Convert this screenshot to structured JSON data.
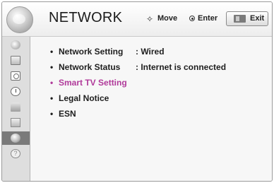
{
  "header": {
    "title": "NETWORK",
    "hints": {
      "move_label": "Move",
      "move_icon": "four-way-arrow-icon",
      "enter_label": "Enter",
      "enter_icon": "enter-dot-icon"
    },
    "exit_button": {
      "label": "Exit",
      "icon": "exit-key-icon"
    }
  },
  "sidebar": {
    "items": [
      {
        "icon": "picture-icon",
        "selected": false
      },
      {
        "icon": "screen-icon",
        "selected": false
      },
      {
        "icon": "audio-icon",
        "selected": false
      },
      {
        "icon": "time-icon",
        "selected": false
      },
      {
        "icon": "lock-icon",
        "selected": false
      },
      {
        "icon": "option-icon",
        "selected": false
      },
      {
        "icon": "network-icon",
        "selected": true
      },
      {
        "icon": "help-icon",
        "selected": false,
        "glyph": "?"
      }
    ]
  },
  "content": {
    "items": [
      {
        "bullet": "•",
        "label": "Network Setting",
        "value": ": Wired",
        "highlighted": false
      },
      {
        "bullet": "•",
        "label": "Network Status",
        "value": ": Internet is connected",
        "highlighted": false
      },
      {
        "bullet": "•",
        "label": "Smart TV Setting",
        "value": "",
        "highlighted": true
      },
      {
        "bullet": "•",
        "label": "Legal Notice",
        "value": "",
        "highlighted": false
      },
      {
        "bullet": "•",
        "label": "ESN",
        "value": "",
        "highlighted": false
      }
    ]
  },
  "colors": {
    "highlight": "#b03a9a",
    "text": "#1e1e1e",
    "sidebar_selected": "#7a7a7a"
  }
}
